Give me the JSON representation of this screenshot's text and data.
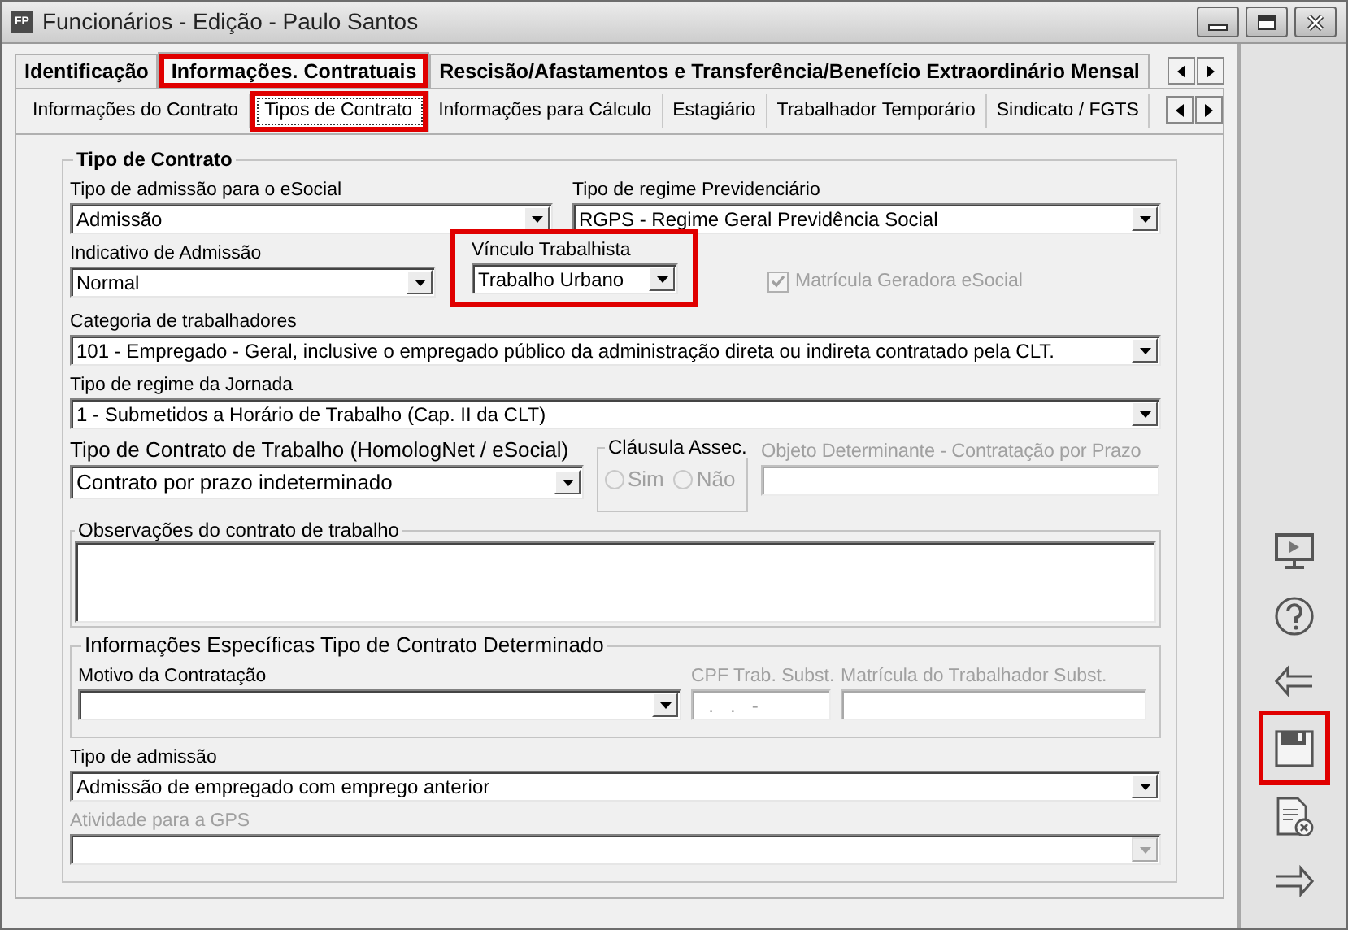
{
  "window": {
    "app_badge": "FP",
    "title": "Funcionários - Edição - Paulo Santos"
  },
  "tabs": [
    {
      "label": "Identificação",
      "selected": false,
      "highlighted": false
    },
    {
      "label": "Informações. Contratuais",
      "selected": true,
      "highlighted": true
    },
    {
      "label": "Rescisão/Afastamentos e Transferência/Benefício Extraordinário Mensal",
      "selected": false,
      "highlighted": false
    }
  ],
  "subtabs": [
    {
      "label": "Informações do Contrato",
      "selected": false,
      "highlighted": false
    },
    {
      "label": "Tipos de Contrato",
      "selected": true,
      "highlighted": true
    },
    {
      "label": "Informações para Cálculo",
      "selected": false,
      "highlighted": false
    },
    {
      "label": "Estagiário",
      "selected": false,
      "highlighted": false
    },
    {
      "label": "Trabalhador Temporário",
      "selected": false,
      "highlighted": false
    },
    {
      "label": "Sindicato / FGTS",
      "selected": false,
      "highlighted": false
    }
  ],
  "group": {
    "title": "Tipo de Contrato",
    "rows": [
      [
        {
          "kind": "select",
          "label": "Tipo de admissão para o eSocial",
          "value": "Admissão",
          "disabled": false,
          "highlighted": false
        },
        {
          "kind": "select",
          "label": "Tipo de regime Previdenciário",
          "value": "RGPS - Regime Geral Previdência Social",
          "disabled": false,
          "highlighted": false
        }
      ],
      [
        {
          "kind": "select",
          "label": "Indicativo de Admissão",
          "value": "Normal",
          "disabled": false,
          "highlighted": false
        },
        {
          "kind": "select",
          "label": "Vínculo Trabalhista",
          "value": "Trabalho Urbano",
          "disabled": false,
          "highlighted": true
        },
        {
          "kind": "check",
          "label": "Matrícula Geradora eSocial",
          "checked": true,
          "disabled": true,
          "highlighted": false
        }
      ],
      [
        {
          "kind": "select",
          "label": "Categoria de trabalhadores",
          "value": "101 - Empregado - Geral, inclusive o empregado público da administração direta ou indireta contratado pela CLT.",
          "disabled": false,
          "highlighted": false
        }
      ],
      [
        {
          "kind": "select",
          "label": "Tipo de regime da Jornada",
          "value": "1 - Submetidos a Horário de Trabalho (Cap. II da CLT)",
          "disabled": false,
          "highlighted": false
        }
      ],
      [
        {
          "kind": "select",
          "label": "Tipo de Contrato de Trabalho (HomologNet / eSocial)",
          "value": "Contrato por prazo indeterminado",
          "disabled": false,
          "highlighted": false
        },
        {
          "kind": "radios",
          "label": "Cláusula Assec.",
          "disabled": true,
          "highlighted": false,
          "options": [
            {
              "label": "Sim",
              "selected": false
            },
            {
              "label": "Não",
              "selected": false
            }
          ]
        },
        {
          "kind": "text",
          "label": "Objeto Determinante - Contratação por Prazo",
          "disabled": true,
          "highlighted": false
        }
      ],
      [
        {
          "kind": "memo",
          "label": "Observações do contrato de trabalho",
          "disabled": false,
          "highlighted": false
        }
      ],
      [
        {
          "kind": "subgroup",
          "label": "Informações Específicas Tipo de Contrato Determinado",
          "disabled": false,
          "highlighted": false,
          "fields": [
            {
              "kind": "select",
              "label": "Motivo da Contratação",
              "disabled": false,
              "highlighted": false
            },
            {
              "kind": "text",
              "label": "CPF Trab. Subst.",
              "value": "  .   .   -",
              "disabled": true,
              "highlighted": false
            },
            {
              "kind": "text",
              "label": "Matrícula do Trabalhador Subst.",
              "disabled": true,
              "highlighted": false
            }
          ]
        }
      ],
      [
        {
          "kind": "select",
          "label": "Tipo de admissão",
          "value": "Admissão de empregado com emprego anterior",
          "disabled": false,
          "highlighted": false
        }
      ],
      [
        {
          "kind": "select",
          "label": "Atividade para a GPS",
          "disabled": true,
          "highlighted": false
        }
      ]
    ]
  },
  "toolbar": [
    {
      "kind": "screen",
      "highlighted": false
    },
    {
      "kind": "help",
      "highlighted": false
    },
    {
      "kind": "back",
      "highlighted": false
    },
    {
      "kind": "save",
      "highlighted": true
    },
    {
      "kind": "cancel-document",
      "highlighted": false
    },
    {
      "kind": "forward",
      "highlighted": false
    }
  ]
}
